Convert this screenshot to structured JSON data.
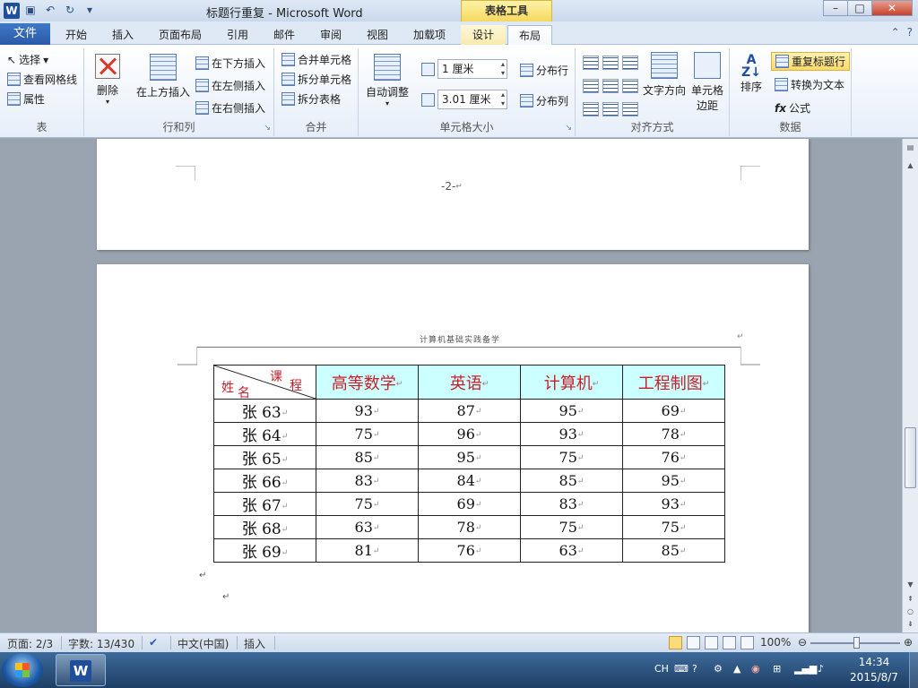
{
  "titlebar": {
    "app_logo": "W",
    "qat_icons": [
      "save-icon",
      "undo-icon",
      "redo-icon",
      "customize-icon"
    ],
    "title": "标题行重复 - Microsoft Word",
    "context_group": "表格工具",
    "window_buttons": [
      "–",
      "□",
      "✕"
    ]
  },
  "tabs": {
    "file": "文件",
    "items": [
      "开始",
      "插入",
      "页面布局",
      "引用",
      "邮件",
      "审阅",
      "视图",
      "加载项"
    ],
    "context": [
      "设计",
      "布局"
    ],
    "active": "布局"
  },
  "ribbon": {
    "table_group": {
      "label": "表",
      "select": "选择",
      "gridlines": "查看网格线",
      "properties": "属性"
    },
    "rows_cols_group": {
      "label": "行和列",
      "delete": "删除",
      "insert_above": "在上方插入",
      "insert_below": "在下方插入",
      "insert_left": "在左侧插入",
      "insert_right": "在右侧插入"
    },
    "merge_group": {
      "label": "合并",
      "merge_cells": "合并单元格",
      "split_cells": "拆分单元格",
      "split_table": "拆分表格"
    },
    "cell_size_group": {
      "label": "单元格大小",
      "autofit": "自动调整",
      "height_value": "1 厘米",
      "width_value": "3.01 厘米",
      "distribute_rows": "分布行",
      "distribute_cols": "分布列"
    },
    "alignment_group": {
      "label": "对齐方式",
      "text_direction": "文字方向",
      "cell_margins_l1": "单元格",
      "cell_margins_l2": "边距"
    },
    "data_group": {
      "label": "数据",
      "sort": "排序",
      "repeat_header": "重复标题行",
      "convert_to_text": "转换为文本",
      "formula": "公式",
      "formula_glyph": "fx"
    }
  },
  "document": {
    "page1_number": "-2-",
    "header_text": "计算机基础实践备学",
    "table": {
      "diag_course": "课",
      "diag_course2": "程",
      "diag_name": "姓",
      "diag_name2": "名",
      "headers": [
        "高等数学",
        "英语",
        "计算机",
        "工程制图"
      ],
      "rows": [
        {
          "name": "张 63",
          "values": [
            "93",
            "87",
            "95",
            "69"
          ]
        },
        {
          "name": "张 64",
          "values": [
            "75",
            "96",
            "93",
            "78"
          ]
        },
        {
          "name": "张 65",
          "values": [
            "85",
            "95",
            "75",
            "76"
          ]
        },
        {
          "name": "张 66",
          "values": [
            "83",
            "84",
            "85",
            "95"
          ]
        },
        {
          "name": "张 67",
          "values": [
            "75",
            "69",
            "83",
            "93"
          ]
        },
        {
          "name": "张 68",
          "values": [
            "63",
            "78",
            "75",
            "75"
          ]
        },
        {
          "name": "张 69",
          "values": [
            "81",
            "76",
            "63",
            "85"
          ]
        }
      ]
    }
  },
  "statusbar": {
    "page": "页面: 2/3",
    "words": "字数: 13/430",
    "language": "中文(中国)",
    "mode": "插入",
    "zoom": "100%"
  },
  "taskbar": {
    "ime": "CH",
    "time": "14:34",
    "date": "2015/8/7"
  }
}
